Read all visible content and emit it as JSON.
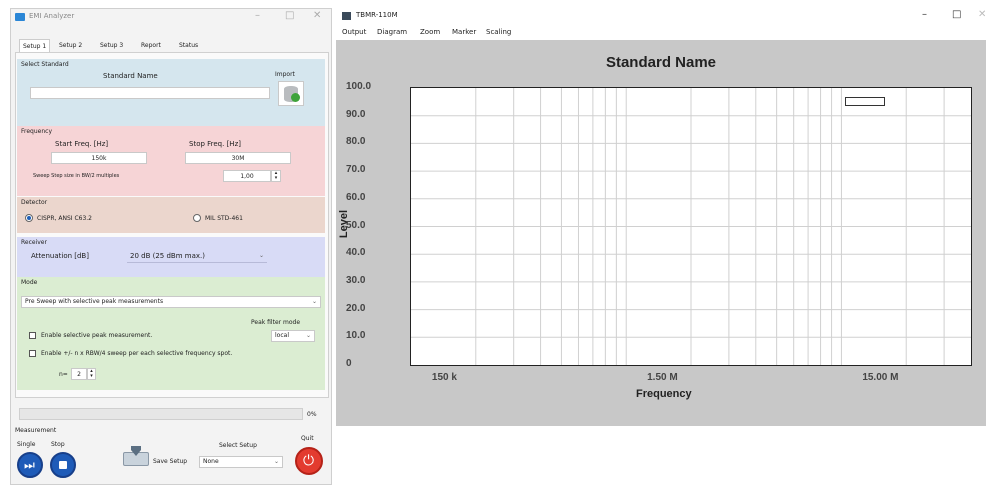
{
  "left_window": {
    "title": "EMI Analyzer",
    "tabs": [
      "Setup 1",
      "Setup 2",
      "Setup 3",
      "Report",
      "Status"
    ],
    "select_standard": {
      "section_label": "Select Standard",
      "name_label": "Standard Name",
      "name_value": "",
      "import_label": "Import"
    },
    "frequency": {
      "section_label": "Frequency",
      "start_label": "Start Freq. [Hz]",
      "start_value": "150k",
      "stop_label": "Stop Freq. [Hz]",
      "stop_value": "30M",
      "step_label": "Sweep Step size in BW/2 multiples",
      "step_value": "1,00"
    },
    "detector": {
      "section_label": "Detector",
      "option_cispr": "CISPR, ANSI C63.2",
      "option_mil": "MIL STD-461",
      "selected": "CISPR, ANSI C63.2"
    },
    "receiver": {
      "section_label": "Receiver",
      "attenuation_label": "Attenuation [dB]",
      "attenuation_value": "20 dB (25 dBm max.)"
    },
    "mode": {
      "section_label": "Mode",
      "mode_value": "Pre Sweep with selective peak measurements",
      "peak_filter_label": "Peak filter mode",
      "peak_filter_value": "local",
      "enable_selective_label": "Enable selective peak measurement.",
      "enable_sweep_label": "Enable +/- n x RBW/4 sweep per each selective frequency spot.",
      "n_label": "n=",
      "n_value": "2"
    },
    "progress": {
      "value": 0,
      "label": "0%"
    },
    "measurement": {
      "section_label": "Measurement",
      "single_label": "Single",
      "stop_label": "Stop",
      "save_setup_label": "Save Setup",
      "select_setup_label": "Select Setup",
      "select_setup_value": "None",
      "quit_label": "Quit"
    }
  },
  "right_window": {
    "title": "TBMR-110M",
    "menu": [
      "Output",
      "Diagram",
      "Zoom",
      "Marker",
      "Scaling"
    ]
  },
  "chart_data": {
    "type": "line",
    "title": "Standard Name",
    "xlabel": "Frequency",
    "ylabel": "Level",
    "x_scale": "log",
    "xlim": [
      100000,
      40000000
    ],
    "ylim": [
      0,
      100
    ],
    "ytick_labels": [
      "0",
      "10.0",
      "20.0",
      "30.0",
      "40.0",
      "50.0",
      "60.0",
      "70.0",
      "80.0",
      "90.0",
      "100.0"
    ],
    "xtick_labels": [
      "150 k",
      "1.50 M",
      "15.00 M"
    ],
    "xtick_values": [
      150000,
      1500000,
      15000000
    ],
    "grid": true,
    "legend": "top-right",
    "series": []
  }
}
